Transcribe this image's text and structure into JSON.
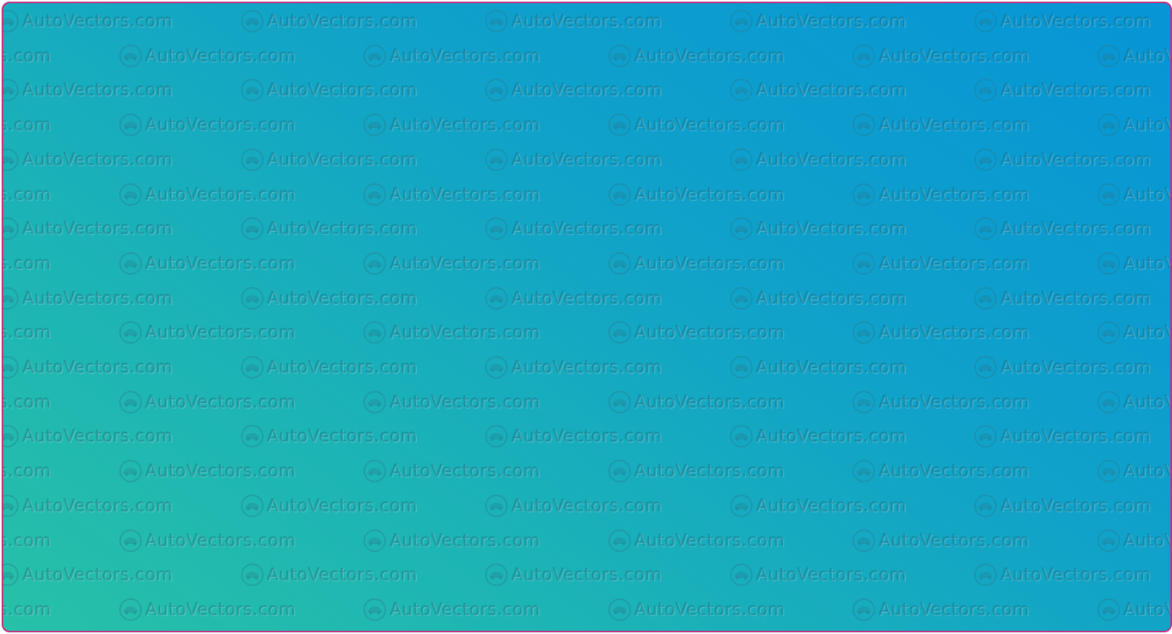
{
  "watermark": {
    "text": "AutoVectors.com",
    "icon": "autovectors-logo-icon"
  },
  "colors": {
    "border": "#c2307f",
    "gradient_top_right": "#0695d6",
    "gradient_bottom_left": "#27c1a7"
  }
}
